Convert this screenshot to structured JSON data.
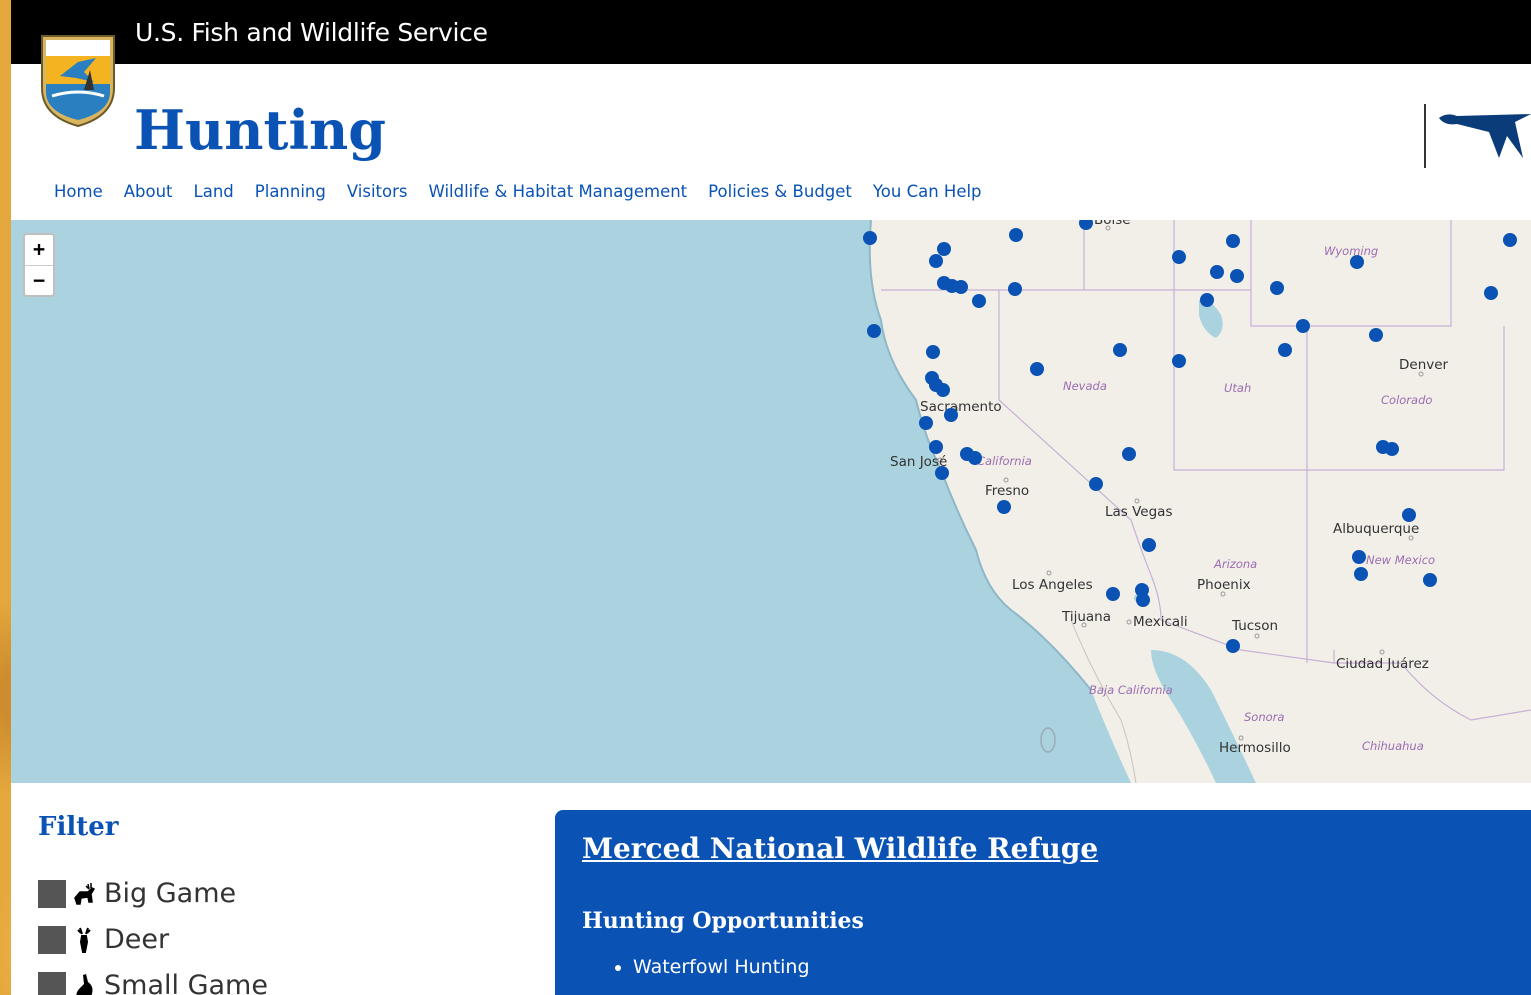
{
  "header": {
    "agency": "U.S. Fish and Wildlife Service",
    "title": "Hunting"
  },
  "nav": [
    "Home",
    "About",
    "Land",
    "Planning",
    "Visitors",
    "Wildlife & Habitat Management",
    "Policies & Budget",
    "You Can Help"
  ],
  "map": {
    "zoom_in": "+",
    "zoom_out": "−",
    "marker_color": "#0a53b4",
    "cities": [
      "Boise",
      "Sacramento",
      "San José",
      "Fresno",
      "Las Vegas",
      "Los Angeles",
      "Tijuana",
      "Mexicali",
      "Phoenix",
      "Tucson",
      "Denver",
      "Albuquerque",
      "Ciudad Juárez",
      "Hermosillo"
    ],
    "states": [
      "Wyoming",
      "Nevada",
      "Utah",
      "Colorado",
      "California",
      "Arizona",
      "New Mexico",
      "Baja California",
      "Sonora",
      "Chihuahua"
    ]
  },
  "filter": {
    "title": "Filter",
    "items": [
      {
        "label": "Big Game",
        "icon": "elk-icon"
      },
      {
        "label": "Deer",
        "icon": "deer-icon"
      },
      {
        "label": "Small Game",
        "icon": "rabbit-icon"
      }
    ]
  },
  "refuge": {
    "name": "Merced National Wildlife Refuge",
    "section": "Hunting Opportunities",
    "opportunities": [
      "Waterfowl Hunting"
    ]
  }
}
